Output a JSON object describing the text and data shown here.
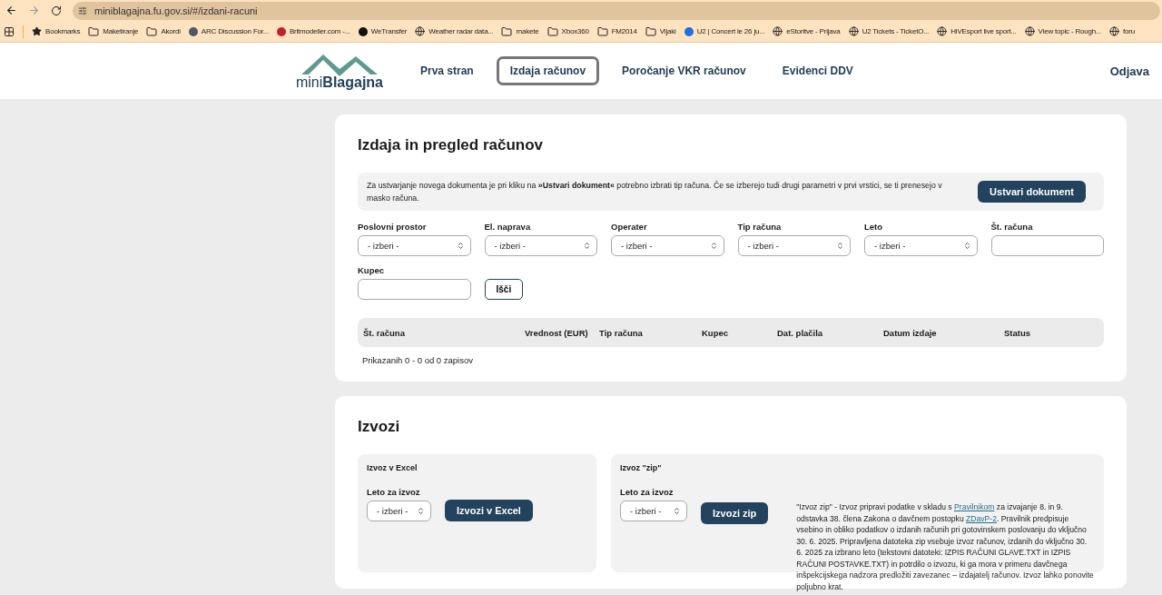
{
  "browser": {
    "url": "miniblagajna.fu.gov.si/#/izdani-racuni",
    "bookmarks": [
      {
        "label": "Bookmarks",
        "kind": "star"
      },
      {
        "label": "Maketiranje",
        "kind": "folder"
      },
      {
        "label": "Akordi",
        "kind": "folder"
      },
      {
        "label": "ARC Discussion For...",
        "kind": "site"
      },
      {
        "label": "Britmodeller.com -...",
        "kind": "target"
      },
      {
        "label": "WeTransfer",
        "kind": "we"
      },
      {
        "label": "Weather radar data...",
        "kind": "globe"
      },
      {
        "label": "makete",
        "kind": "folder"
      },
      {
        "label": "Xbox360",
        "kind": "folder"
      },
      {
        "label": "FM2014",
        "kind": "folder"
      },
      {
        "label": "Vijaki",
        "kind": "folder"
      },
      {
        "label": "U2 | Concert le 26 ju...",
        "kind": "tile"
      },
      {
        "label": "eStoritve - Prijava",
        "kind": "globe"
      },
      {
        "label": "U2 Tickets - TicketO...",
        "kind": "globe"
      },
      {
        "label": "HiVEsport live sport...",
        "kind": "globe"
      },
      {
        "label": "View topic - Rough...",
        "kind": "globe"
      },
      {
        "label": "foru",
        "kind": "globe"
      }
    ]
  },
  "header": {
    "logo": {
      "light": "mini",
      "bold": "Blagajna"
    },
    "nav": [
      {
        "label": "Prva stran",
        "selected": false
      },
      {
        "label": "Izdaja računov",
        "selected": true
      },
      {
        "label": "Poročanje VKR računov",
        "selected": false
      },
      {
        "label": "Evidenci DDV",
        "selected": false
      }
    ],
    "logout": "Odjava"
  },
  "invoices": {
    "title": "Izdaja in pregled računov",
    "info": "Za ustvarjanje novega dokumenta je pri kliku na **»Ustvari dokument«** potrebno izbrati tip računa. Če se izberejo tudi drugi parametri v prvi vrstici, se ti prenesejo v masko računa.",
    "create_button": "Ustvari dokument",
    "filters": [
      {
        "label": "Poslovni prostor",
        "kind": "select",
        "value": "- izberi -"
      },
      {
        "label": "El. naprava",
        "kind": "select",
        "value": "- izberi -"
      },
      {
        "label": "Operater",
        "kind": "select",
        "value": "- izberi -"
      },
      {
        "label": "Tip računa",
        "kind": "select",
        "value": "- izberi -"
      },
      {
        "label": "Leto",
        "kind": "select",
        "value": "- izberi -"
      },
      {
        "label": "Št. računa",
        "kind": "input"
      },
      {
        "label": "Kupec",
        "kind": "input"
      }
    ],
    "search_button": "Išči",
    "table": {
      "columns": [
        "Št. računa",
        "Vrednost (EUR)",
        "Tip računa",
        "Kupec",
        "Dat. plačila",
        "Datum izdaje",
        "Status"
      ]
    },
    "summary": "Prikazanih 0 - 0 od 0 zapisov"
  },
  "exports": {
    "title": "Izvozi",
    "excel": {
      "title": "Izvoz v Excel",
      "year_label": "Leto za izvoz",
      "year_value": "- izberi -",
      "button": "Izvozi v Excel"
    },
    "zip": {
      "title": "Izvoz \"zip\"",
      "year_label": "Leto za izvoz",
      "year_value": "- izberi -",
      "button": "Izvozi zip",
      "description": [
        {
          "kind": "text",
          "text": "\"Izvoz zip\" - Izvoz pripravi podatke v skladu s "
        },
        {
          "kind": "link",
          "text": "Pravilnikom"
        },
        {
          "kind": "text",
          "text": " za izvajanje 8. in 9. odstavka 38. člena Zakona o davčnem postopku "
        },
        {
          "kind": "link",
          "text": "ZDavP-2"
        },
        {
          "kind": "text",
          "text": ". Pravilnik predpisuje vsebino in obliko podatkov o izdanih računih pri gotovinskem poslovanju do vključno 30. 6. 2025. Pripravljena datoteka zip vsebuje izvoz računov, izdanih do vključno 30. 6. 2025 za izbrano leto (tekstovni datoteki: IZPIS RAČUNI GLAVE.TXT in IZPIS RAČUNI POSTAVKE.TXT) in potrdilo o izvozu, ki ga mora v primeru davčnega inšpekcijskega nadzora predložiti zavezanec – izdajatelj računov. Izvoz lahko ponovite poljubno krat."
        }
      ]
    }
  }
}
